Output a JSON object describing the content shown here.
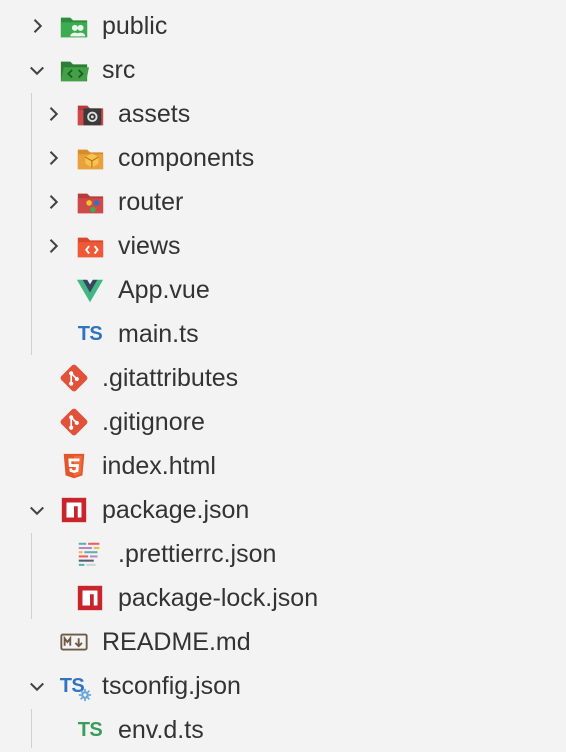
{
  "explorer": {
    "items": [
      {
        "label": "public",
        "icon": "folder-public-icon",
        "chevron": "collapsed"
      },
      {
        "label": "src",
        "icon": "folder-src-icon",
        "chevron": "expanded"
      },
      {
        "label": "assets",
        "icon": "folder-assets-icon",
        "chevron": "collapsed"
      },
      {
        "label": "components",
        "icon": "folder-components-icon",
        "chevron": "collapsed"
      },
      {
        "label": "router",
        "icon": "folder-router-icon",
        "chevron": "collapsed"
      },
      {
        "label": "views",
        "icon": "folder-views-icon",
        "chevron": "collapsed"
      },
      {
        "label": "App.vue",
        "icon": "vue-file-icon"
      },
      {
        "label": "main.ts",
        "icon": "typescript-file-icon",
        "icon_text": "TS"
      },
      {
        "label": ".gitattributes",
        "icon": "git-file-icon"
      },
      {
        "label": ".gitignore",
        "icon": "git-file-icon"
      },
      {
        "label": "index.html",
        "icon": "html5-file-icon"
      },
      {
        "label": "package.json",
        "icon": "npm-file-icon",
        "chevron": "expanded"
      },
      {
        "label": ".prettierrc.json",
        "icon": "prettier-file-icon"
      },
      {
        "label": "package-lock.json",
        "icon": "npm-file-icon"
      },
      {
        "label": "README.md",
        "icon": "markdown-file-icon",
        "icon_text": "M↓"
      },
      {
        "label": "tsconfig.json",
        "icon": "tsconfig-file-icon",
        "icon_text": "TS",
        "chevron": "expanded"
      },
      {
        "label": "env.d.ts",
        "icon": "typescript-def-file-icon",
        "icon_text": "TS"
      }
    ]
  },
  "colors": {
    "background": "#f3f3f3",
    "text": "#333333",
    "chevron": "#424242",
    "ts_blue": "#2f74c0",
    "ts_green": "#3a9d5a",
    "git": "#e2513a",
    "npm": "#c8242c",
    "html": "#e4552a",
    "vue_green": "#41b883",
    "vue_dark": "#34495e"
  }
}
